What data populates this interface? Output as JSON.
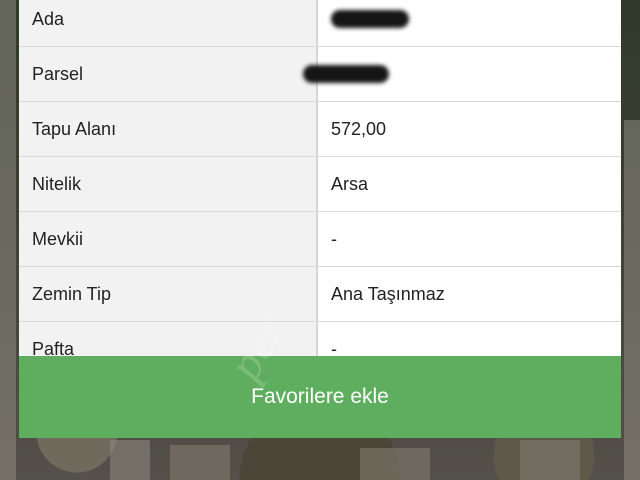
{
  "parcel_details": {
    "rows": [
      {
        "label": "Ada",
        "value": "",
        "redacted": true
      },
      {
        "label": "Parsel",
        "value": "",
        "redacted": true
      },
      {
        "label": "Tapu Alanı",
        "value": "572,00"
      },
      {
        "label": "Nitelik",
        "value": "Arsa"
      },
      {
        "label": "Mevkii",
        "value": "-"
      },
      {
        "label": "Zemin Tip",
        "value": "Ana Taşınmaz"
      },
      {
        "label": "Pafta",
        "value": "-"
      }
    ]
  },
  "actions": {
    "favorites_label": "Favorilere ekle"
  },
  "colors": {
    "button_green": "#5fae5f",
    "label_bg": "#f2f2f2",
    "value_bg": "#ffffff"
  },
  "watermark": "per"
}
